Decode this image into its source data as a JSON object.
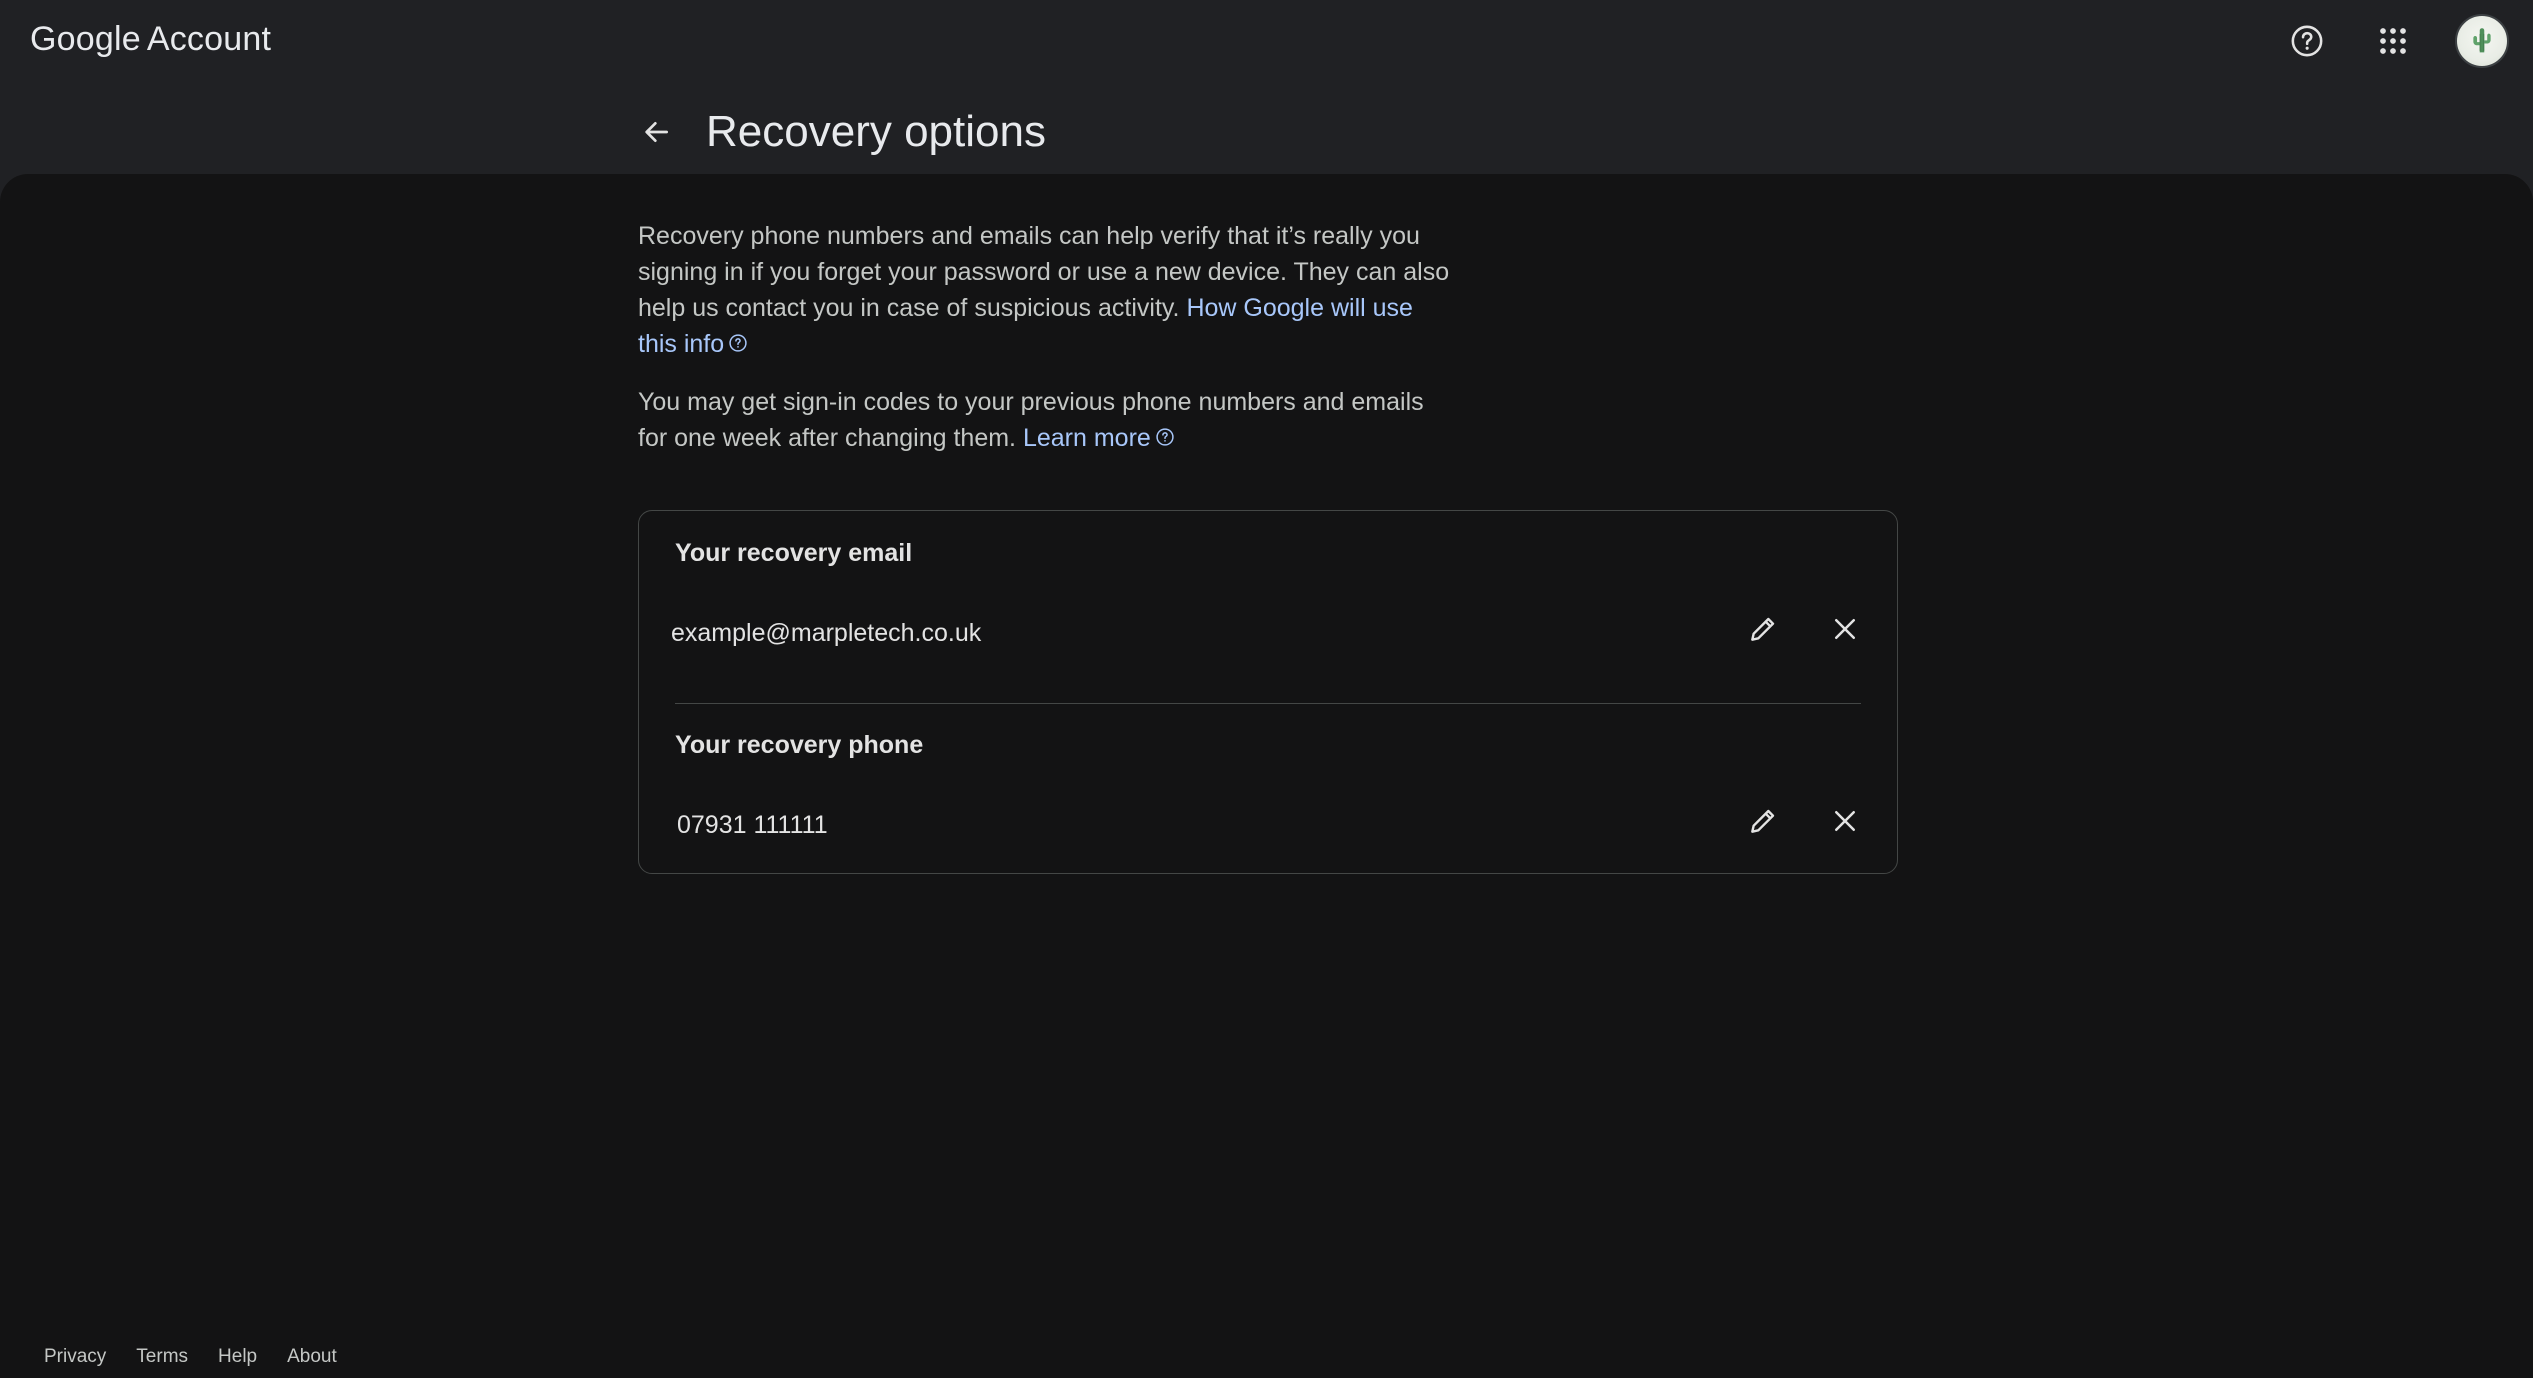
{
  "header": {
    "brand_google": "Google",
    "brand_account": "Account",
    "help_icon": "help-circle-icon",
    "apps_icon": "apps-grid-icon",
    "avatar_icon": "cactus-avatar"
  },
  "page": {
    "title": "Recovery options",
    "back_icon": "arrow-back-icon"
  },
  "intro": {
    "paragraph1_text": "Recovery phone numbers and emails can help verify that it’s really you signing in if you forget your password or use a new device. They can also help us contact you in case of suspicious activity. ",
    "paragraph1_link": "How Google will use this info",
    "paragraph2_text": "You may get sign-in codes to your previous phone numbers and emails for one week after changing them. ",
    "paragraph2_link": "Learn more"
  },
  "recovery": {
    "email_label": "Your recovery email",
    "email_value": "example@marpletech.co.uk",
    "phone_label": "Your recovery phone",
    "phone_value": "07931 111111",
    "edit_icon": "pencil-icon",
    "remove_icon": "close-icon"
  },
  "footer": {
    "links": [
      "Privacy",
      "Terms",
      "Help",
      "About"
    ]
  },
  "colors": {
    "background": "#202124",
    "surface": "#131314",
    "link": "#a8c7fa",
    "border": "#444746"
  }
}
